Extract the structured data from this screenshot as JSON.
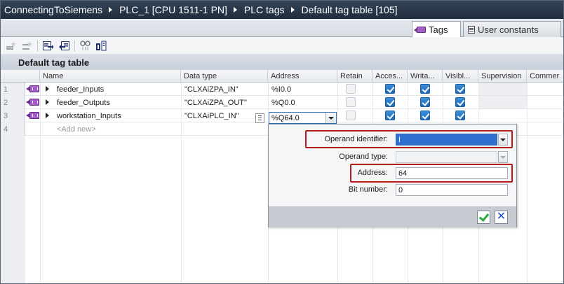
{
  "breadcrumb": [
    "ConnectingToSiemens",
    "PLC_1 [CPU 1511-1 PN]",
    "PLC tags",
    "Default tag table [105]"
  ],
  "tabs": [
    {
      "label": "Tags",
      "active": true,
      "icon": "tag-icon"
    },
    {
      "label": "User constants",
      "active": false,
      "icon": "user-constants-icon"
    }
  ],
  "toolbar_icons": [
    "add-row-icon",
    "insert-row-icon",
    "export-icon",
    "import-icon",
    "monitor-icon",
    "all-tags-icon"
  ],
  "section_title": "Default tag table",
  "columns": [
    "Name",
    "Data type",
    "Address",
    "Retain",
    "Acces...",
    "Writa...",
    "Visibl...",
    "Supervision",
    "Commer"
  ],
  "rows": [
    {
      "num": "1",
      "name": "feeder_Inputs",
      "datatype": "\"CLXAiZPA_IN\"",
      "address": "%I0.0",
      "retain": false,
      "accessible": true,
      "writable": true,
      "visible": true
    },
    {
      "num": "2",
      "name": "feeder_Outputs",
      "datatype": "\"CLXAiZPA_OUT\"",
      "address": "%Q0.0",
      "retain": false,
      "accessible": true,
      "writable": true,
      "visible": true
    },
    {
      "num": "3",
      "name": "workstation_Inputs",
      "datatype": "\"CLXAiPLC_IN\"",
      "address": "%Q64.0",
      "retain": false,
      "accessible": true,
      "writable": true,
      "visible": true
    }
  ],
  "add_new": {
    "num": "4",
    "label": "<Add new>"
  },
  "popup": {
    "operand_identifier_label": "Operand identifier:",
    "operand_identifier_value": "I",
    "operand_type_label": "Operand type:",
    "operand_type_value": "",
    "address_label": "Address:",
    "address_value": "64",
    "bit_number_label": "Bit number:",
    "bit_number_value": "0"
  },
  "colors": {
    "highlight_box": "#b81a1a",
    "selection_blue": "#2f6fd0",
    "title_bar": "#2a3a4e"
  }
}
